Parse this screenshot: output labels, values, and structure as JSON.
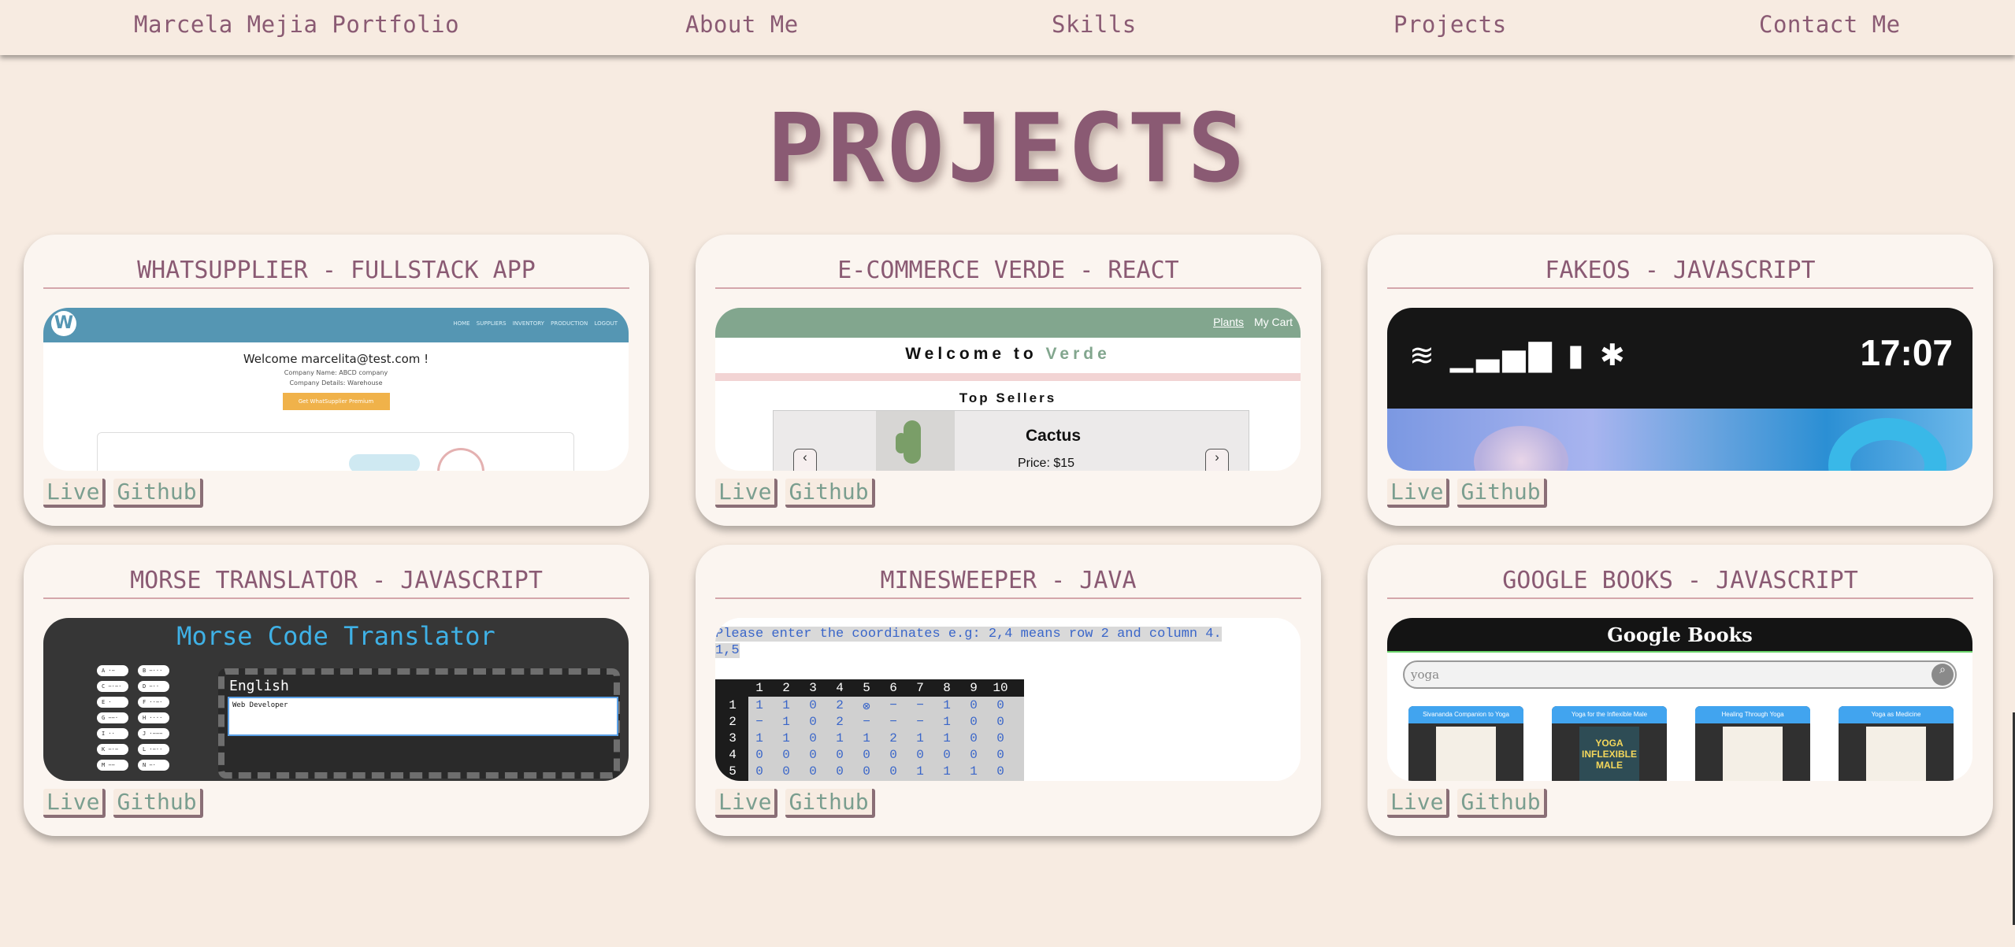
{
  "nav": {
    "brand": "Marcela Mejia Portfolio",
    "about": "About Me",
    "skills": "Skills",
    "projects": "Projects",
    "contact": "Contact Me"
  },
  "page_title": "PROJECTS",
  "link_labels": {
    "live": "Live",
    "github": "Github"
  },
  "projects": [
    {
      "title": "WHATSUPPLIER - FULLSTACK APP"
    },
    {
      "title": "E-COMMERCE VERDE - REACT"
    },
    {
      "title": "FAKEOS - JAVASCRIPT"
    },
    {
      "title": "MORSE TRANSLATOR - JAVASCRIPT"
    },
    {
      "title": "MINESWEEPER - JAVA"
    },
    {
      "title": "GOOGLE BOOKS - JAVASCRIPT"
    }
  ],
  "whatsupplier_preview": {
    "logo_text": "W",
    "nav": "HOME SUPPLIERS INVENTORY PRODUCTION LOGOUT",
    "welcome": "Welcome marcelita@test.com !",
    "company_name": "Company Name: ABCD company",
    "company_details": "Company Details: Warehouse",
    "premium_button": "Get WhatSupplier Premium"
  },
  "verde_preview": {
    "plants": "Plants",
    "cart": "My Cart",
    "welcome_prefix": "Welcome to ",
    "welcome_brand": "Verde",
    "top_sellers": "Top Sellers",
    "product_name": "Cactus",
    "product_price": "Price: $15",
    "prev": "‹",
    "next": "›"
  },
  "fakeos_preview": {
    "status_icons": "≋ ▁▃▅▇ ▮ ✱",
    "time": "17:07"
  },
  "morse_preview": {
    "title": "Morse Code Translator",
    "language": "English",
    "input_text": "Web Developer"
  },
  "minesweeper_preview": {
    "prompt": "Please enter the coordinates e.g: 2,4 means row 2 and column 4.",
    "input": "1,5",
    "cols": [
      "1",
      "2",
      "3",
      "4",
      "5",
      "6",
      "7",
      "8",
      "9",
      "10"
    ],
    "rows": [
      [
        "1",
        "1",
        "0",
        "2",
        "⊗",
        "−",
        "−",
        "1",
        "0",
        "0"
      ],
      [
        "−",
        "1",
        "0",
        "2",
        "−",
        "−",
        "−",
        "1",
        "0",
        "0"
      ],
      [
        "1",
        "1",
        "0",
        "1",
        "1",
        "2",
        "1",
        "1",
        "0",
        "0"
      ],
      [
        "0",
        "0",
        "0",
        "0",
        "0",
        "0",
        "0",
        "0",
        "0",
        "0"
      ],
      [
        "0",
        "0",
        "0",
        "0",
        "0",
        "0",
        "1",
        "1",
        "1",
        "0"
      ]
    ]
  },
  "googlebooks_preview": {
    "title": "Google Books",
    "search_value": "yoga",
    "books": [
      "Sivananda Companion to Yoga",
      "Yoga for the Inflexible Male",
      "Healing Through Yoga",
      "Yoga as Medicine"
    ],
    "cover2_text": "YOGA INFLEXIBLE MALE"
  }
}
